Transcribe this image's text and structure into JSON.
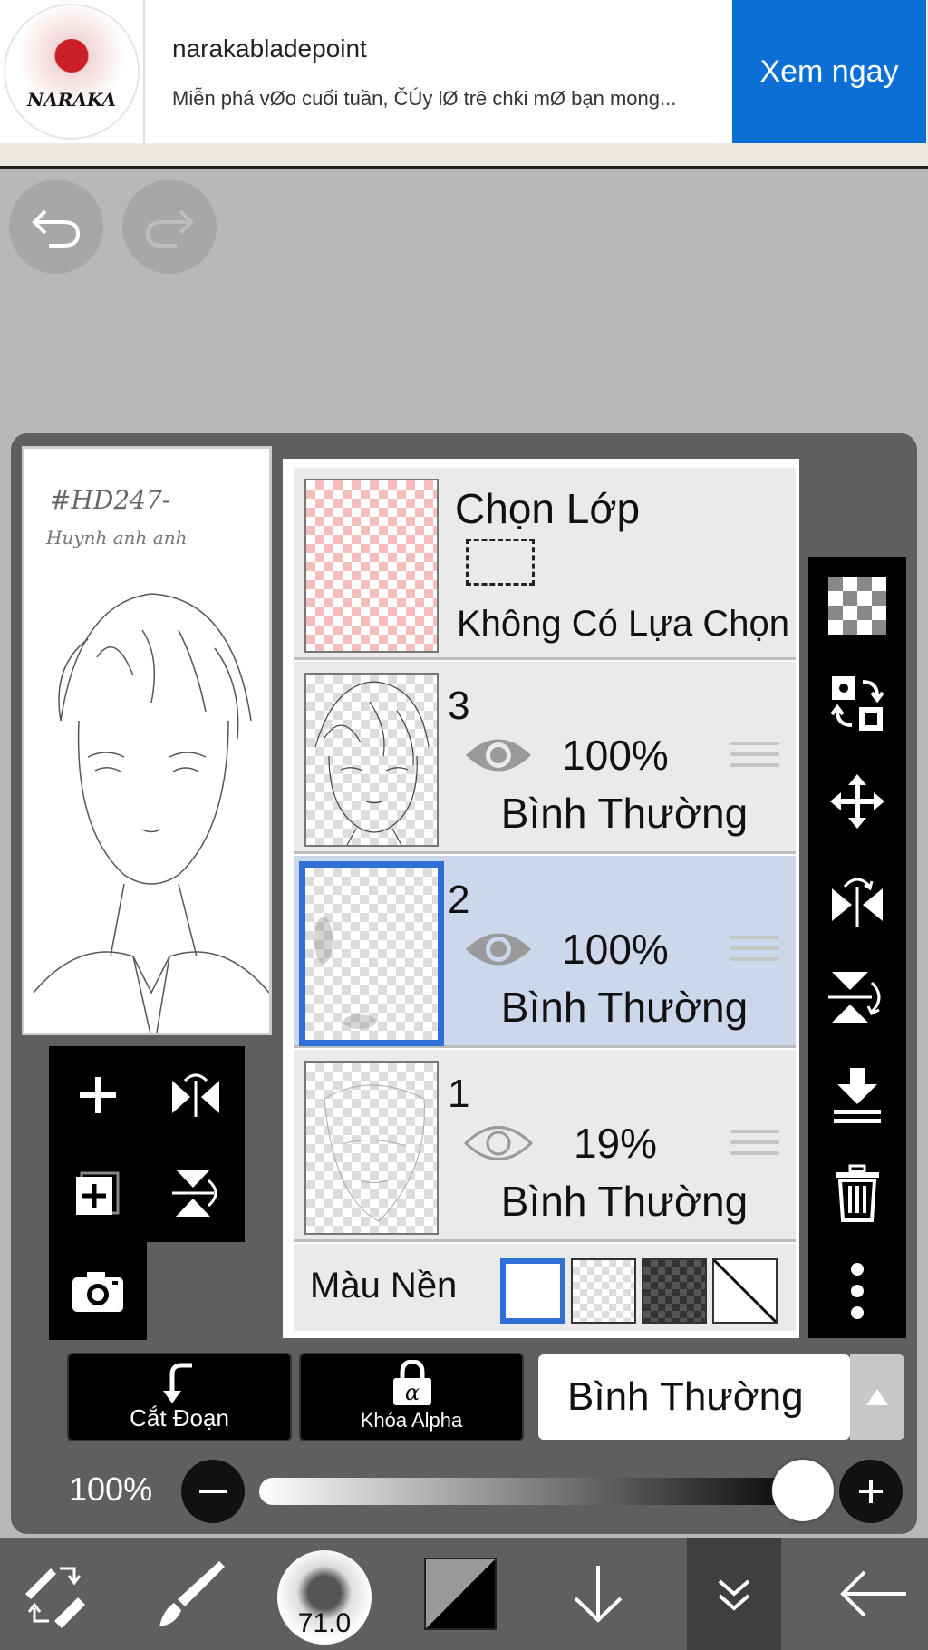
{
  "ad": {
    "title": "narakabladepoint",
    "description": "Miễn phá vØo cuối tuần, ČÚy lØ trê chƙi mØ bạn mong...",
    "cta": "Xem ngay",
    "logo_text": "NARAKA"
  },
  "preview": {
    "signature_line1": "#HD247-",
    "signature_line2": "Huynh anh anh"
  },
  "selection_layer": {
    "title": "Chọn Lớp",
    "status": "Không Có Lựa Chọn"
  },
  "layers": [
    {
      "number": "3",
      "opacity": "100%",
      "blend": "Bình Thường",
      "visible": true,
      "selected": false
    },
    {
      "number": "2",
      "opacity": "100%",
      "blend": "Bình Thường",
      "visible": true,
      "selected": true
    },
    {
      "number": "1",
      "opacity": "19%",
      "blend": "Bình Thường",
      "visible": false,
      "selected": false
    }
  ],
  "background": {
    "label": "Màu Nền",
    "options": [
      "white",
      "checker-light",
      "checker-dark",
      "none"
    ],
    "selected": "white"
  },
  "actions": {
    "clip_label": "Cắt Đoạn",
    "alpha_lock_label": "Khóa Alpha",
    "blend_mode": "Bình Thường"
  },
  "opacity_slider": {
    "label": "100%",
    "value": 1.0
  },
  "bottom_toolbar": {
    "brush_size": "71.0"
  },
  "colors": {
    "accent": "#2f6fd6",
    "selected_layer_bg": "#cbd8ec",
    "ad_button": "#0b6fd6",
    "panel_bg": "#5f5f5f"
  },
  "icons": {
    "right_toolbar": [
      "transparency-icon",
      "transfer-icon",
      "move-icon",
      "flip-horizontal-icon",
      "flip-vertical-icon",
      "merge-down-icon",
      "trash-icon",
      "more-icon"
    ],
    "left_toolbar": [
      "add-layer-icon",
      "flip-layer-icon",
      "duplicate-layer-icon",
      "rotate-layer-icon",
      "camera-icon"
    ]
  }
}
